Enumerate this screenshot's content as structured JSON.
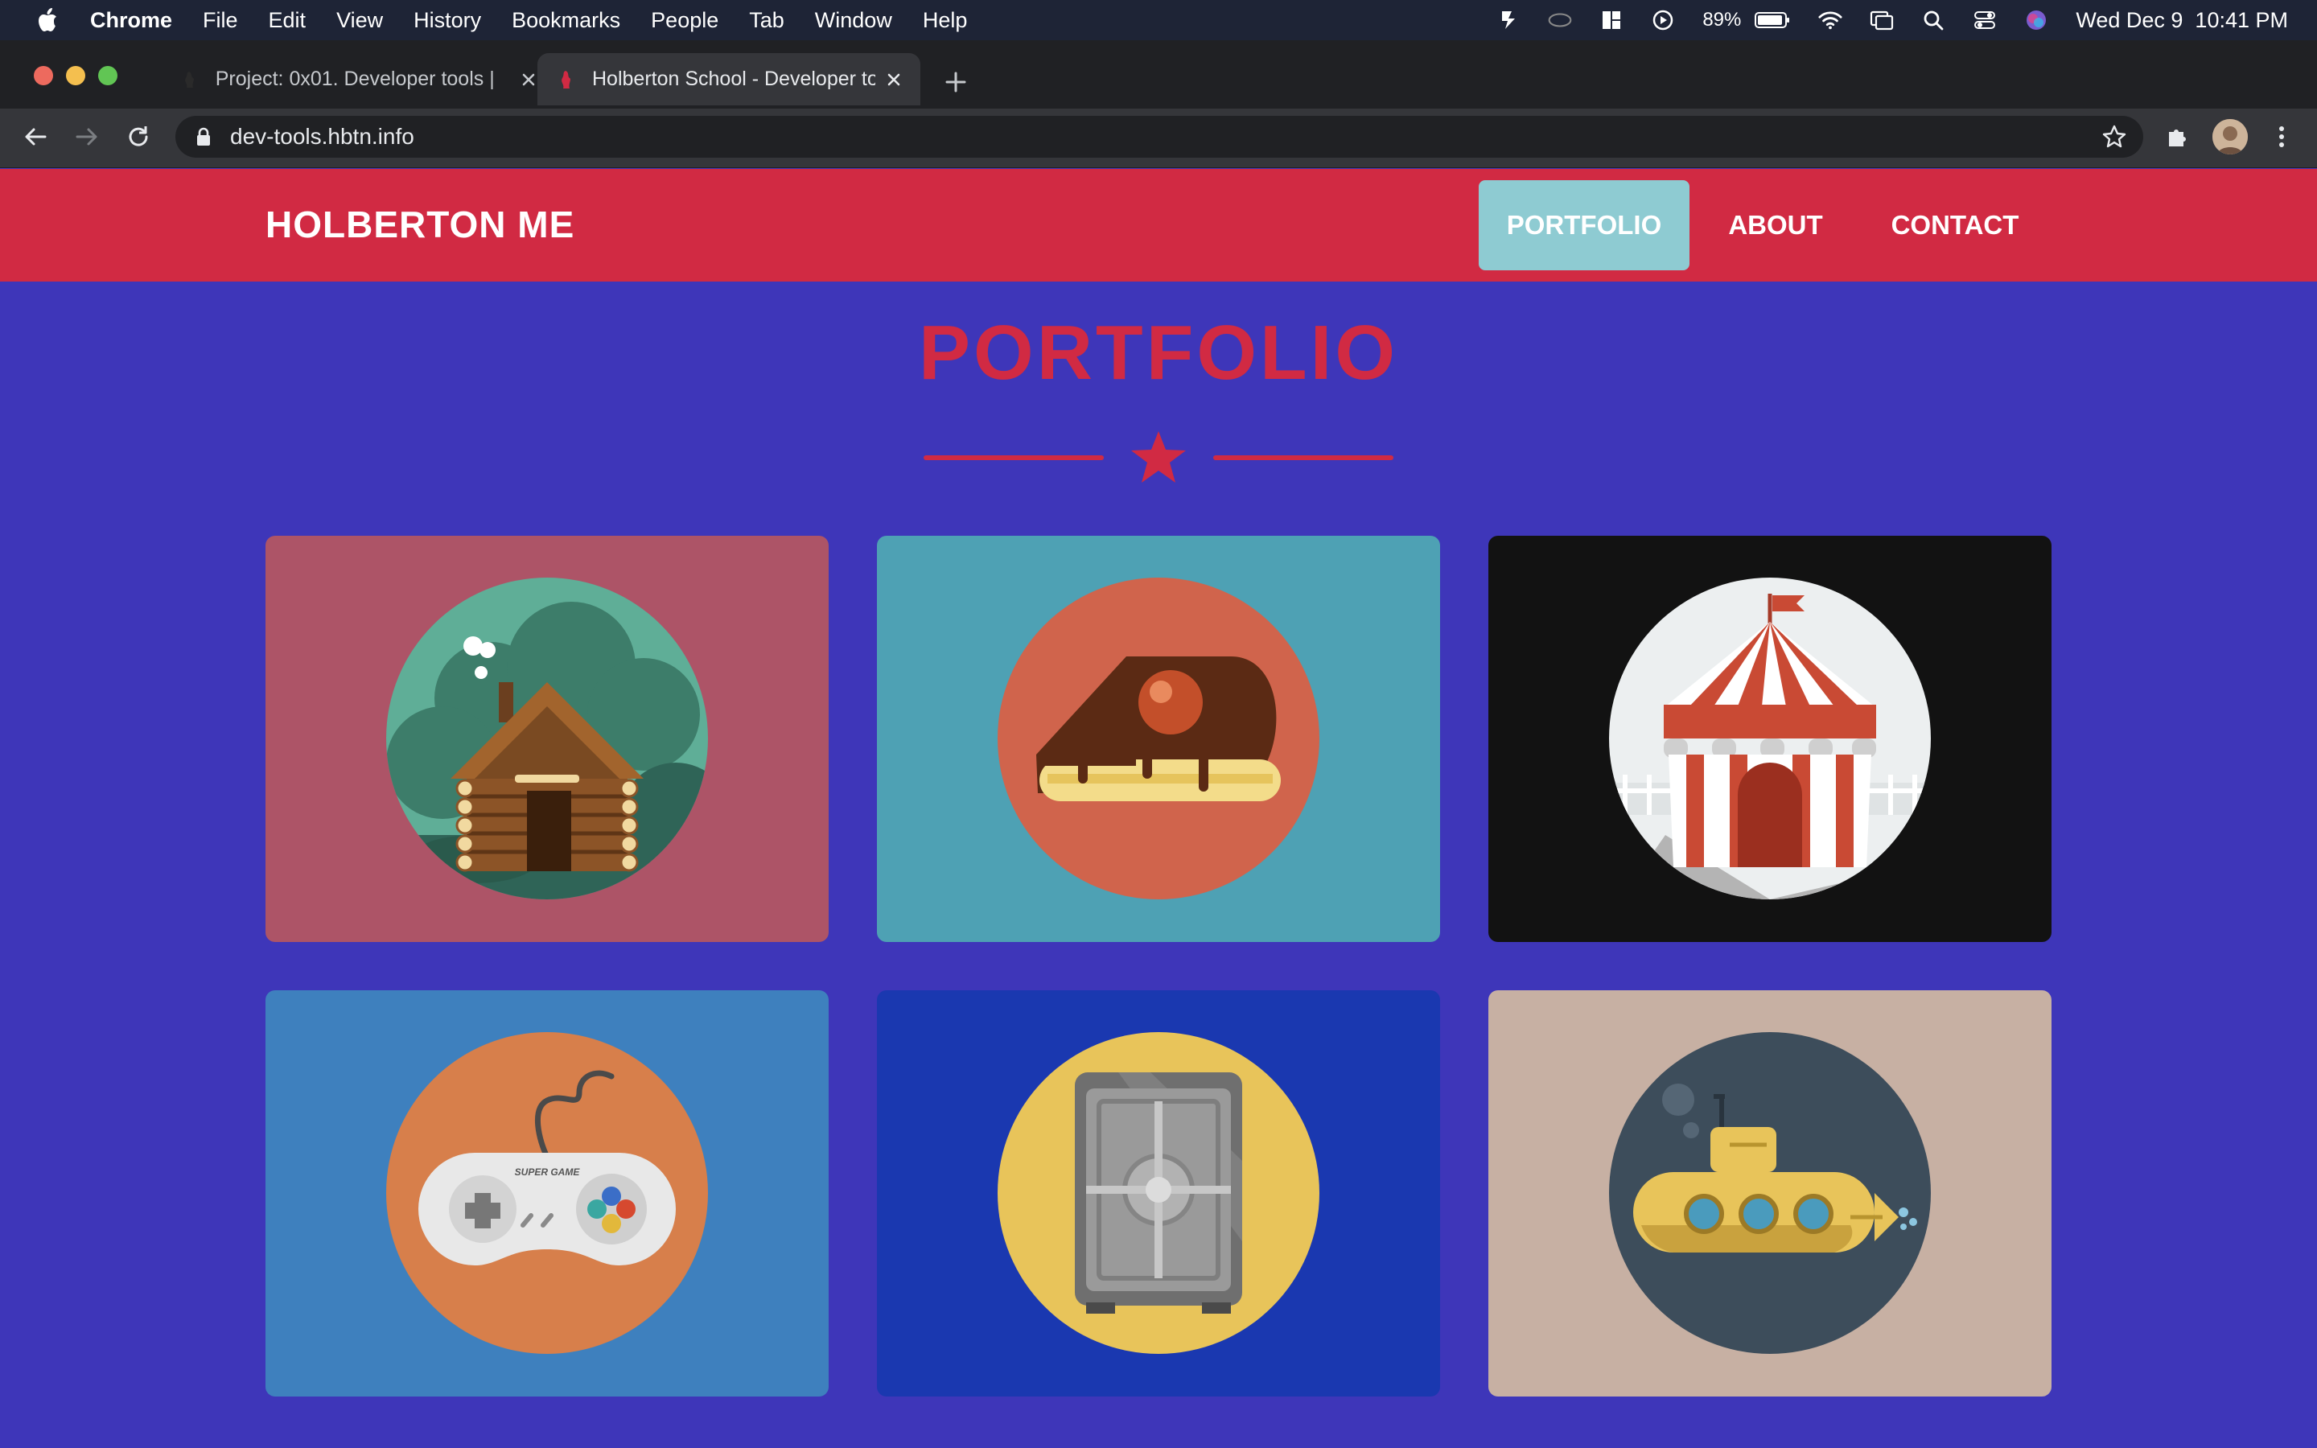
{
  "menubar": {
    "app_name": "Chrome",
    "items": [
      "File",
      "Edit",
      "View",
      "History",
      "Bookmarks",
      "People",
      "Tab",
      "Window",
      "Help"
    ],
    "battery": "89%",
    "clock": "Wed Dec 9  10:41 PM"
  },
  "browser": {
    "tabs": [
      {
        "title": "Project: 0x01. Developer tools | ",
        "active": false
      },
      {
        "title": "Holberton School - Developer to",
        "active": true
      }
    ],
    "url": "dev-tools.hbtn.info"
  },
  "site": {
    "brand": "HOLBERTON ME",
    "nav": [
      {
        "label": "PORTFOLIO",
        "active": true
      },
      {
        "label": "ABOUT",
        "active": false
      },
      {
        "label": "CONTACT",
        "active": false
      }
    ],
    "section_title": "PORTFOLIO",
    "portfolio_items": [
      {
        "icon": "log-cabin-icon",
        "background": "#ad5467"
      },
      {
        "icon": "cake-slice-icon",
        "background": "#4ea1b4"
      },
      {
        "icon": "circus-tent-icon",
        "background": "#121212"
      },
      {
        "icon": "game-controller-icon",
        "background": "#3e80be"
      },
      {
        "icon": "safe-icon",
        "background": "#1a38b0"
      },
      {
        "icon": "submarine-icon",
        "background": "#c7b0a3"
      }
    ],
    "controller_text": "SUPER GAME"
  },
  "colors": {
    "header_red": "#d12a43",
    "page_bg": "#3e36b9",
    "active_nav": "#8ecbd2"
  }
}
